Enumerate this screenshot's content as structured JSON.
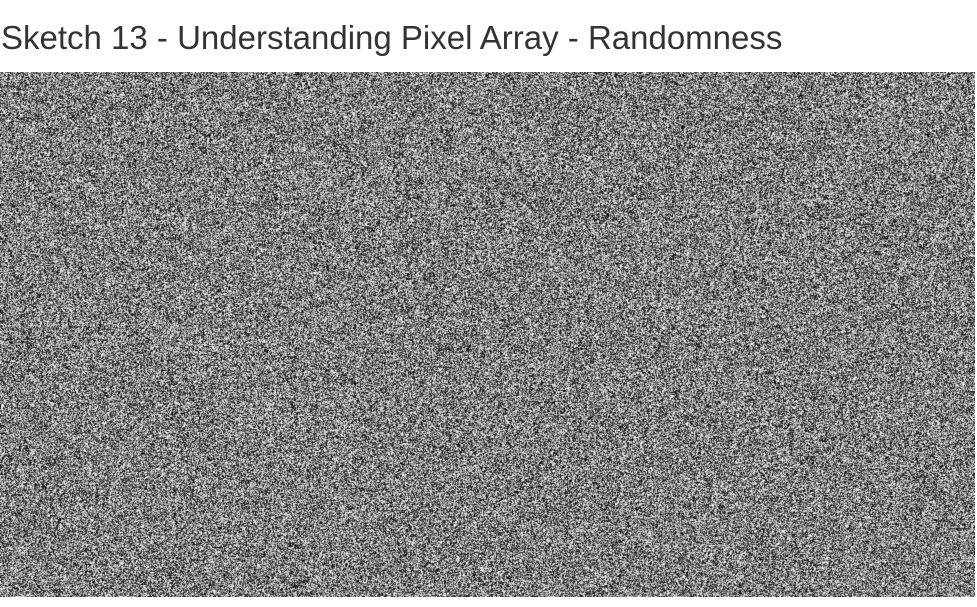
{
  "page": {
    "title": "Sketch 13 - Understanding Pixel Array - Randomness"
  },
  "sketch": {
    "noise": "grayscale-random",
    "value_range": [
      0,
      255
    ],
    "colors": {
      "background": "#ffffff",
      "title": "#333333"
    }
  }
}
